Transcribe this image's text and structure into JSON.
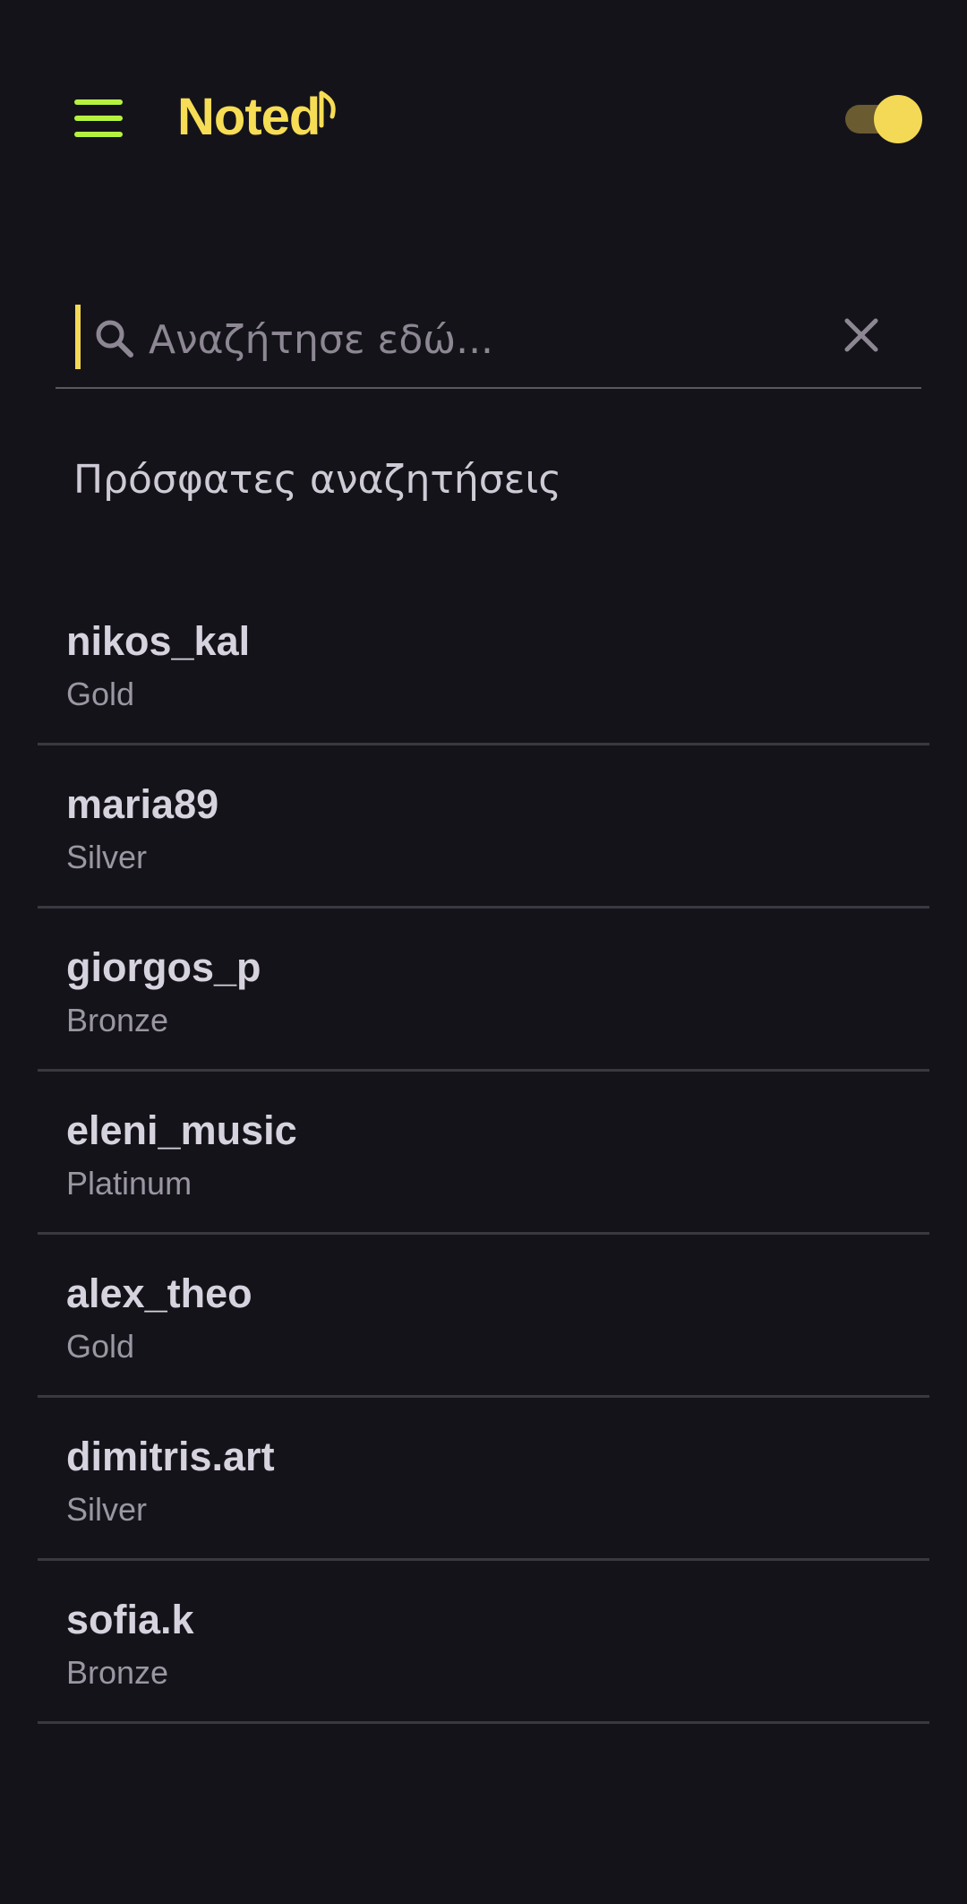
{
  "header": {
    "menu_icon": "hamburger-menu-icon",
    "logo_text": "Noted",
    "logo_icon": "music-note-icon",
    "theme_toggle_on": true,
    "colors": {
      "background": "#15131a",
      "accent_yellow": "#f3d955",
      "menu_green": "#b5f23f"
    }
  },
  "search": {
    "value": "",
    "placeholder": "Αναζήτησε εδώ...",
    "search_icon": "search-icon",
    "clear_icon": "close-icon"
  },
  "recent": {
    "title": "Πρόσφατες αναζητήσεις",
    "items": [
      {
        "name": "nikos_kal",
        "tier": "Gold"
      },
      {
        "name": "maria89",
        "tier": "Silver"
      },
      {
        "name": "giorgos_p",
        "tier": "Bronze"
      },
      {
        "name": "eleni_music",
        "tier": "Platinum"
      },
      {
        "name": "alex_theo",
        "tier": "Gold"
      },
      {
        "name": "dimitris.art",
        "tier": "Silver"
      },
      {
        "name": "sofia.k",
        "tier": "Bronze"
      }
    ]
  }
}
